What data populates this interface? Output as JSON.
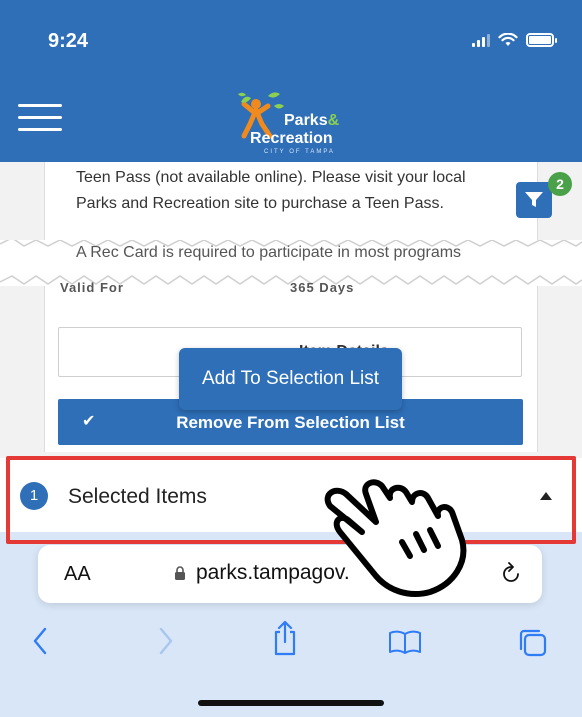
{
  "status_bar": {
    "time": "9:24"
  },
  "header": {
    "logo": {
      "line1": "Parks",
      "amp": "&",
      "line2": "Recreation",
      "line3": "CITY OF TAMPA"
    }
  },
  "card": {
    "text_line1": "Teen Pass (not available online). Please visit your local",
    "text_line2": "Parks and Recreation site to purchase a Teen Pass.",
    "text_line3": "A Rec Card is required to participate in most programs",
    "under_left": "Valid For",
    "under_right": "365 Days"
  },
  "filter": {
    "badge_count": "2"
  },
  "detail": {
    "label": "Item Details"
  },
  "tooltip": {
    "label": "Add To Selection List"
  },
  "remove_button": {
    "label": "Remove From Selection List"
  },
  "selected_items": {
    "count": "1",
    "label": "Selected Items"
  },
  "safari": {
    "text_size": "AA",
    "url": "parks.tampagov."
  },
  "colors": {
    "brand_blue": "#2e6fb8",
    "highlight_red": "#e53935",
    "badge_green": "#4aa14a"
  }
}
